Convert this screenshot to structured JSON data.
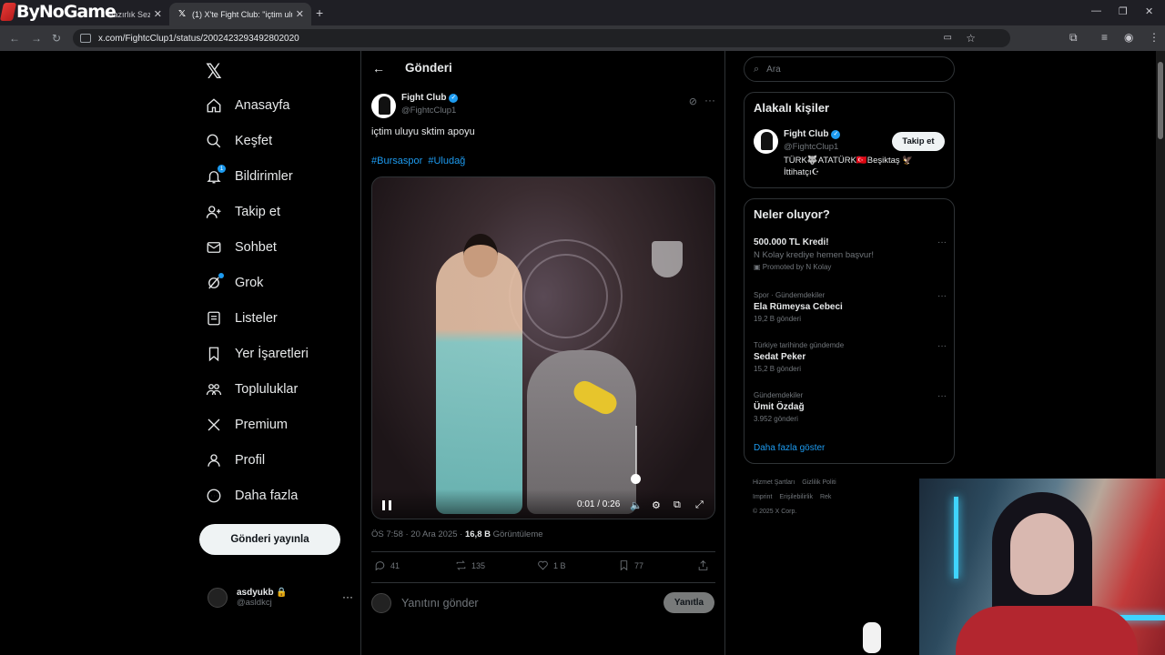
{
  "browser": {
    "brand": "ByNoGame",
    "tabs": [
      {
        "title": "Hazırlık Sezon"
      },
      {
        "title": "(1) X'te Fight Club: \"içtim uluy"
      }
    ],
    "url": "x.com/FightcClup1/status/2002423293492802020"
  },
  "nav": {
    "items": [
      {
        "label": "Anasayfa"
      },
      {
        "label": "Keşfet"
      },
      {
        "label": "Bildirimler",
        "badge": "1"
      },
      {
        "label": "Takip et"
      },
      {
        "label": "Sohbet"
      },
      {
        "label": "Grok"
      },
      {
        "label": "Listeler"
      },
      {
        "label": "Yer İşaretleri"
      },
      {
        "label": "Topluluklar"
      },
      {
        "label": "Premium"
      },
      {
        "label": "Profil"
      },
      {
        "label": "Daha fazla"
      }
    ],
    "post_button": "Gönderi yayınla",
    "account": {
      "name": "asdyukb",
      "handle": "@asldkcj"
    }
  },
  "post": {
    "header": "Gönderi",
    "author_name": "Fight Club",
    "author_handle": "@FightcClup1",
    "text": "içtim uluyu sktim apoyu",
    "hashtags": [
      "#Bursaspor",
      "#Uludağ"
    ],
    "video": {
      "time": "0:01 / 0:26",
      "volume": 0.85
    },
    "meta_time": "ÖS 7:58 · 20 Ara 2025 · ",
    "views_count": "16,8 B",
    "views_label": " Görüntüleme",
    "stats": {
      "replies": "41",
      "reposts": "135",
      "likes": "1 B",
      "bookmarks": "77"
    },
    "reply_placeholder": "Yanıtını gönder",
    "reply_button": "Yanıtla"
  },
  "sidebar": {
    "search_placeholder": "Ara",
    "who_title": "Alakalı kişiler",
    "who": {
      "name": "Fight Club",
      "handle": "@FightcClup1",
      "bio": "TÜRK🐺ATATÜRK🇹🇷Beşiktaş 🦅 İttihatçı☪",
      "follow_label": "Takip et"
    },
    "trends_title": "Neler oluyor?",
    "trends": [
      {
        "category": "",
        "title": "500.000 TL Kredi!",
        "subtitle": "N Kolay krediye hemen başvur!",
        "count": "",
        "promo": "Promoted by N Kolay"
      },
      {
        "category": "Spor · Gündemdekiler",
        "title": "Ela Rümeysa Cebeci",
        "subtitle": "",
        "count": "19,2 B gönderi",
        "promo": ""
      },
      {
        "category": "Türkiye tarihinde gündemde",
        "title": "Sedat Peker",
        "subtitle": "",
        "count": "15,2 B gönderi",
        "promo": ""
      },
      {
        "category": "Gündemdekiler",
        "title": "Ümit Özdağ",
        "subtitle": "",
        "count": "3.952 gönderi",
        "promo": ""
      }
    ],
    "show_more": "Daha fazla göster",
    "footer": [
      "Hizmet Şartları",
      "Gizlilik Politi",
      "Imprint",
      "Erişilebilirlik",
      "Rek",
      "© 2025 X Corp."
    ]
  },
  "colors": {
    "accent": "#1d9bf0",
    "background": "#000000",
    "border": "#2f3336",
    "muted": "#71767b"
  }
}
